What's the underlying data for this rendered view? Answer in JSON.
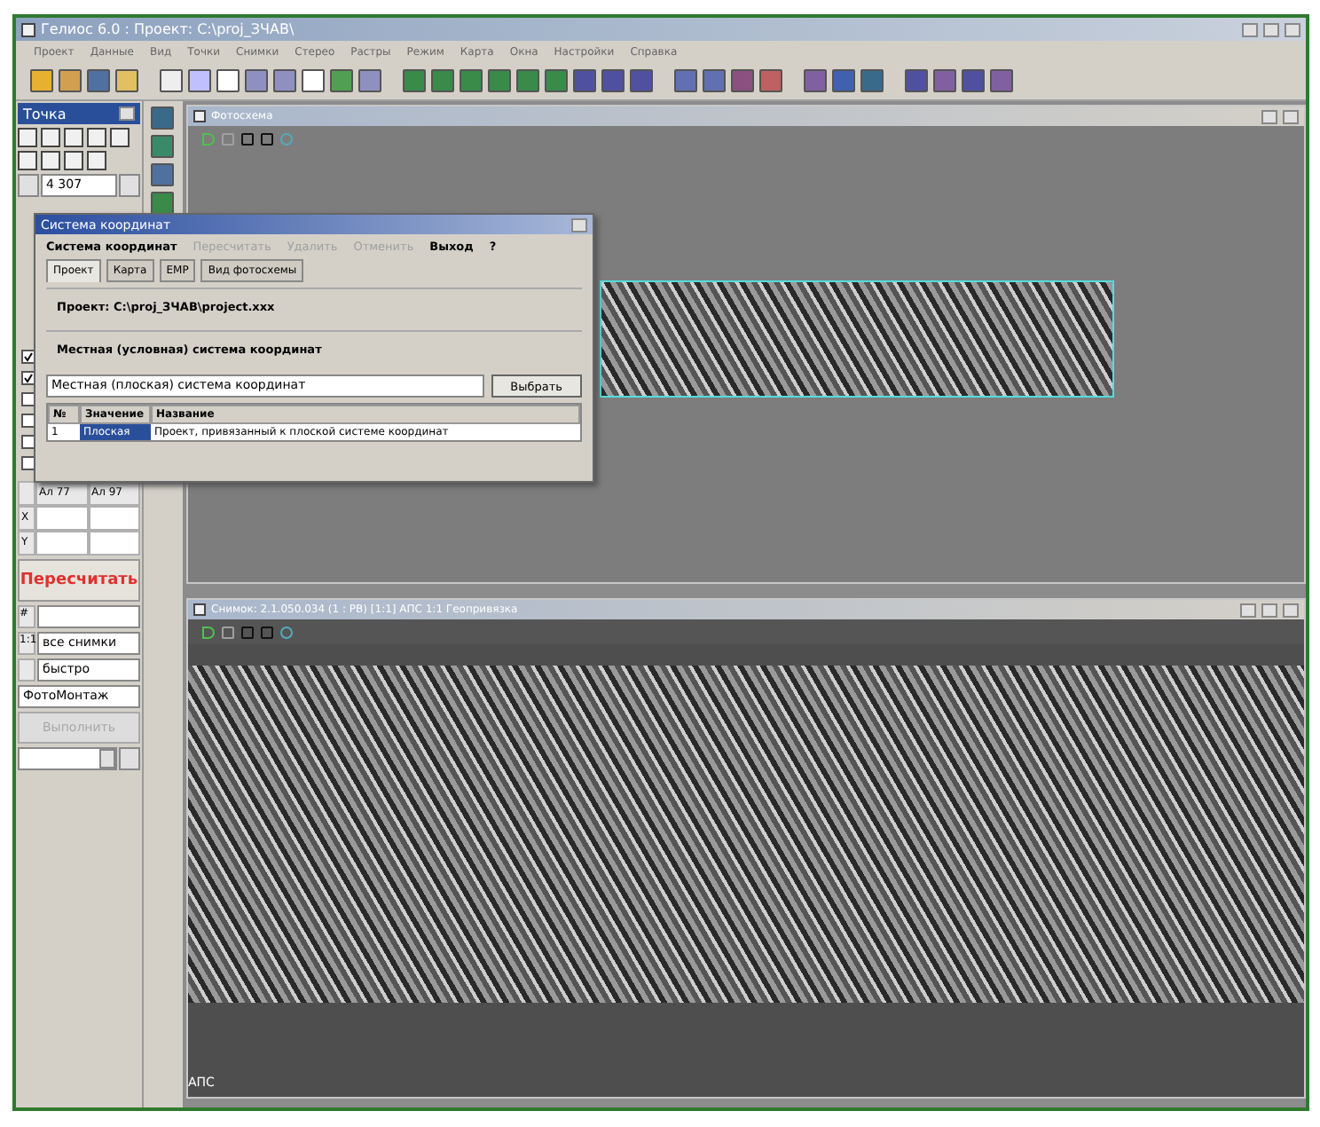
{
  "window": {
    "title": "Гелиос 6.0 : Проект: C:\\proj_ЗЧАВ\\"
  },
  "menu": [
    "Проект",
    "Данные",
    "Вид",
    "Точки",
    "Снимки",
    "Стерео",
    "Растры",
    "Режим",
    "Карта",
    "Окна",
    "Настройки",
    "Справка"
  ],
  "left_panel": {
    "title": "Точка",
    "point_field": "4 307",
    "checks": [
      {
        "checked": true
      },
      {
        "checked": true
      },
      {
        "checked": false
      },
      {
        "checked": false
      },
      {
        "checked": false
      },
      {
        "checked": false
      }
    ],
    "columns": [
      "Ал 77",
      "Ал 97"
    ],
    "rows": [
      "X",
      "Y"
    ],
    "recalc_button": "Пересчитать",
    "fields": [
      {
        "label": "#"
      },
      {
        "label": "1:1",
        "value": "все снимки"
      },
      {
        "value": "быстро"
      }
    ],
    "mode_field": "ФотоМонтаж",
    "run_button": {
      "label": "Выполнить",
      "disabled": true
    }
  },
  "top_window": {
    "title": "Фотосхема"
  },
  "bottom_window": {
    "title": "Снимок: 2.1.050.034 (1 : РВ) [1:1] АПС 1:1 Геопривязка",
    "image_label": "АПС"
  },
  "dialog": {
    "title": "Система координат",
    "menu": [
      {
        "label": "Система координат",
        "disabled": false
      },
      {
        "label": "Пересчитать",
        "disabled": true
      },
      {
        "label": "Удалить",
        "disabled": true
      },
      {
        "label": "Отменить",
        "disabled": true
      },
      {
        "label": "Выход",
        "disabled": false
      },
      {
        "label": "?",
        "disabled": false
      }
    ],
    "tabs": [
      {
        "label": "Проект",
        "selected": true
      },
      {
        "label": "Карта",
        "selected": false
      },
      {
        "label": "ЕМР",
        "selected": false
      },
      {
        "label": "Вид фотосхемы",
        "selected": false
      }
    ],
    "project": "Проект:  C:\\proj_ЗЧАВ\\project.xxx",
    "system_heading": "Местная (условная) система координат",
    "system_field": "Местная (плоская) система координат",
    "choose_button": "Выбрать",
    "table": {
      "columns": [
        "№",
        "Значение",
        "Название"
      ],
      "rows": [
        {
          "cells": [
            "1",
            "Плоская",
            "Проект, привязанный к плоской системе координат"
          ],
          "selected": true
        }
      ]
    }
  }
}
